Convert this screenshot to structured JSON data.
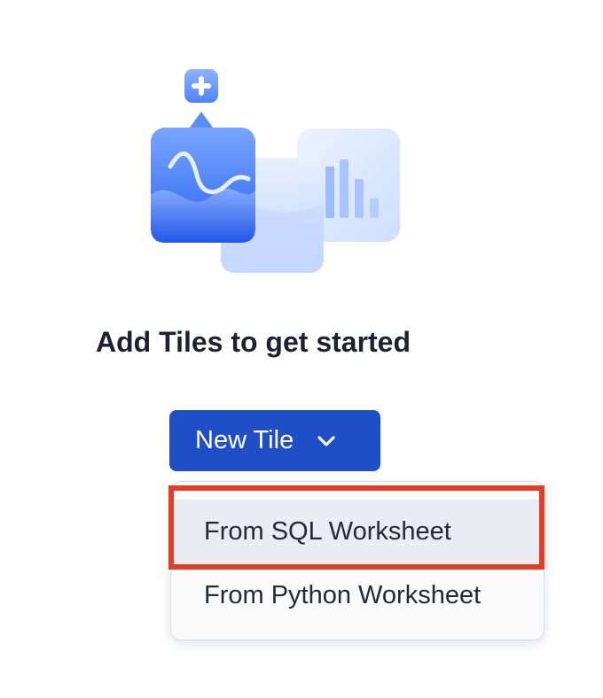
{
  "empty_state": {
    "heading": "Add Tiles to get started"
  },
  "new_tile_button": {
    "label": "New Tile",
    "icon": "chevron-down-icon"
  },
  "dropdown_menu": {
    "items": [
      {
        "label": "From SQL Worksheet",
        "highlighted": true
      },
      {
        "label": "From Python Worksheet",
        "highlighted": false
      }
    ]
  },
  "annotation": {
    "highlight_color": "#e53c28"
  },
  "colors": {
    "button_bg": "#1f4fc6",
    "hover_bg": "#ebecf1",
    "menu_bg": "#fafafb"
  }
}
